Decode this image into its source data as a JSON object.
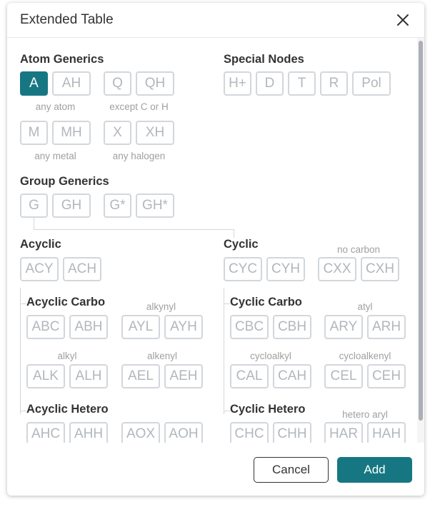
{
  "dialog": {
    "title": "Extended Table"
  },
  "atom_generics": {
    "title": "Atom Generics",
    "any_atom": "any atom",
    "except_c_h": "except C or H",
    "any_metal": "any metal",
    "any_halogen": "any halogen",
    "buttons": [
      "A",
      "AH",
      "Q",
      "QH",
      "M",
      "MH",
      "X",
      "XH"
    ],
    "selected": "A"
  },
  "special_nodes": {
    "title": "Special Nodes",
    "buttons": [
      "H+",
      "D",
      "T",
      "R",
      "Pol"
    ]
  },
  "group_generics": {
    "title": "Group Generics",
    "buttons": [
      "G",
      "GH",
      "G*",
      "GH*"
    ]
  },
  "acyclic": {
    "title": "Acyclic",
    "buttons": [
      "ACY",
      "ACH"
    ],
    "carbo": {
      "title": "Acyclic Carbo",
      "alkynyl": "alkynyl",
      "alkyl": "alkyl",
      "alkenyl": "alkenyl",
      "buttons": [
        "ABC",
        "ABH",
        "AYL",
        "AYH",
        "ALK",
        "ALH",
        "AEL",
        "AEH"
      ]
    },
    "hetero": {
      "title": "Acyclic Hetero",
      "buttons": [
        "AHC",
        "AHH",
        "AOX",
        "AOH"
      ]
    }
  },
  "cyclic": {
    "title": "Cyclic",
    "no_carbon": "no carbon",
    "buttons": [
      "CYC",
      "CYH",
      "CXX",
      "CXH"
    ],
    "carbo": {
      "title": "Cyclic Carbo",
      "atyl": "atyl",
      "cycloalkyl": "cycloalkyl",
      "cycloalkenyl": "cycloalkenyl",
      "buttons": [
        "CBC",
        "CBH",
        "ARY",
        "ARH",
        "CAL",
        "CAH",
        "CEL",
        "CEH"
      ]
    },
    "hetero": {
      "title": "Cyclic Hetero",
      "hetero_aryl": "hetero aryl",
      "buttons": [
        "CHC",
        "CHH",
        "HAR",
        "HAH"
      ]
    }
  },
  "footer": {
    "cancel_label": "Cancel",
    "add_label": "Add"
  },
  "colors": {
    "accent": "#167782",
    "button_border": "#d2d7dc",
    "button_text": "#b2b7bc",
    "caption": "#a0a0a0"
  }
}
